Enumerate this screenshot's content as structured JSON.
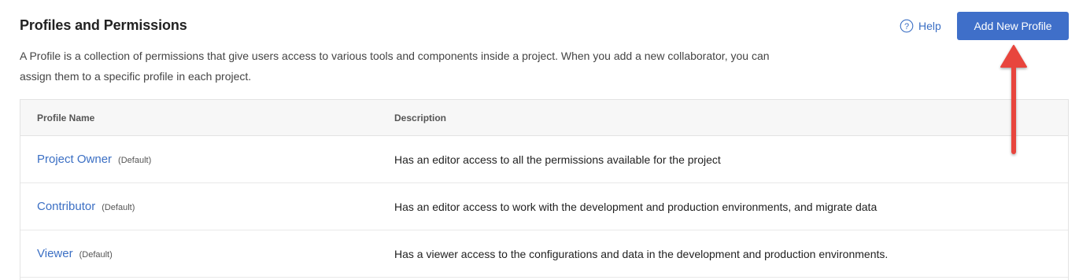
{
  "header": {
    "title": "Profiles and Permissions",
    "description": "A Profile is a collection of permissions that give users access to various tools and components inside a project. When you add a new collaborator, you can assign them to a specific profile in each project.",
    "help_label": "Help",
    "help_icon": "question-circle-icon",
    "add_button_label": "Add New Profile"
  },
  "table": {
    "columns": [
      "Profile Name",
      "Description"
    ],
    "rows": [
      {
        "name": "Project Owner",
        "tag": "(Default)",
        "description": "Has an editor access to all the permissions available for the project"
      },
      {
        "name": "Contributor",
        "tag": "(Default)",
        "description": "Has an editor access to work with the development and production environments, and migrate data"
      },
      {
        "name": "Viewer",
        "tag": "(Default)",
        "description": "Has a viewer access to the configurations and data in the development and production environments."
      }
    ]
  },
  "colors": {
    "accent": "#3f6fc9",
    "link": "#3b6fc4",
    "annotation_arrow": "#e8453c"
  }
}
